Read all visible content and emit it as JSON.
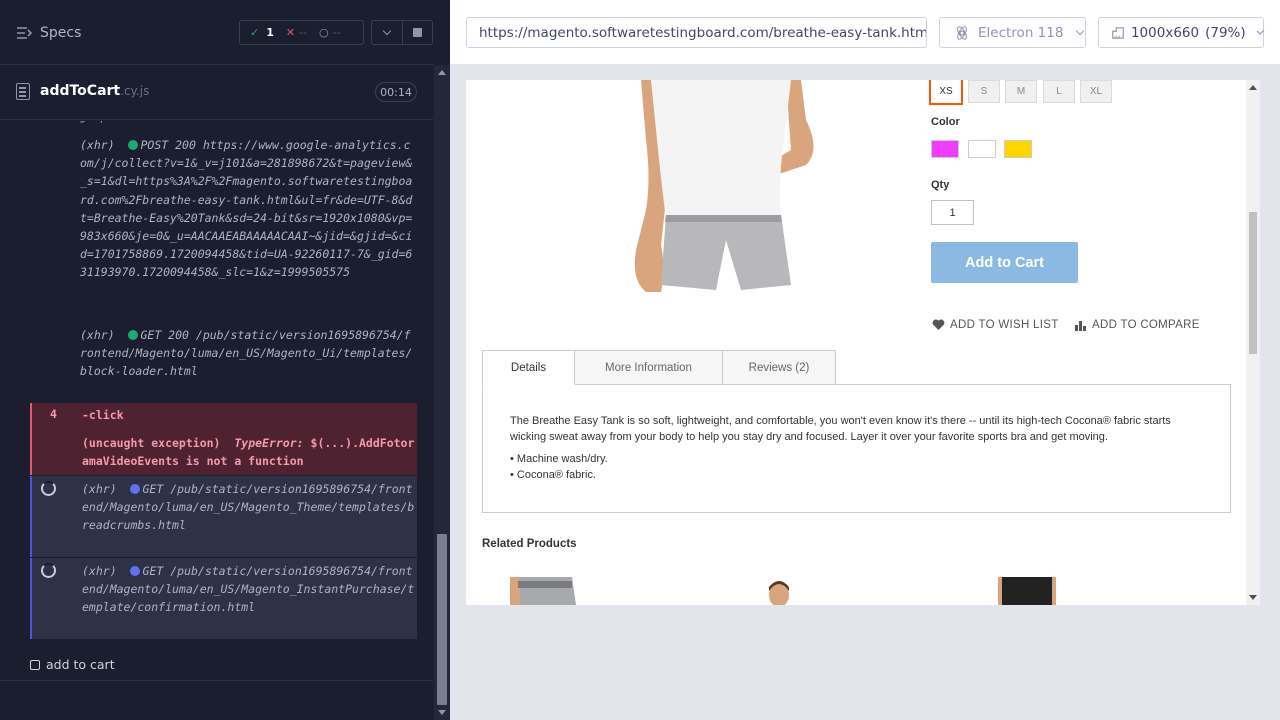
{
  "reporter": {
    "specs_label": "Specs",
    "stats": {
      "passed": "1",
      "failed": "--",
      "pending": "--"
    },
    "spec": {
      "name": "addToCart",
      "ext": ".cy.js",
      "duration": "00:14"
    },
    "commands": [
      {
        "type": "(xhr)",
        "method": "POST 200",
        "url": "https://www.google-analytics.com/j/collect?v=1&_v=j101&a=281898672&t=pageview&_s=1&dl=https%3A%2F%2Fmagento.softwaretestingboard.com%2Fbreathe-easy-tank.html&ul=fr&de=UTF-8&dt=Breathe-Easy%20Tank&sd=24-bit&sr=1920x1080&vp=983x660&je=0&_u=AACAAEABAAAAACAAI~&jid=&gjid=&cid=1701758869.1720094458&tid=UA-92260117-7&_gid=631193970.1720094458&_slc=1&z=1999505575"
      },
      {
        "type": "(xhr)",
        "method": "GET 200",
        "url": "/pub/static/version1695896754/frontend/Magento/luma/en_US/Magento_Ui/templates/block-loader.html"
      },
      {
        "num": "4",
        "name": "-click",
        "error_label": "(uncaught exception)",
        "error_type": "TypeError:",
        "error_msg": "$(...).AddFotoramaVideoEvents is not a function"
      },
      {
        "type": "(xhr)",
        "method": "GET",
        "url": "/pub/static/version1695896754/frontend/Magento/luma/en_US/Magento_Theme/templates/breadcrumbs.html"
      },
      {
        "type": "(xhr)",
        "method": "GET",
        "url": "/pub/static/version1695896754/frontend/Magento/luma/en_US/Magento_InstantPurchase/template/confirmation.html"
      }
    ],
    "test_title": "add to cart"
  },
  "aut": {
    "url": "https://magento.softwaretestingboard.com/breathe-easy-tank.html",
    "browser": "Electron 118",
    "viewport": "1000x660",
    "zoom": "(79%)"
  },
  "page": {
    "sizes": [
      "XS",
      "S",
      "M",
      "L",
      "XL"
    ],
    "selected_size": "XS",
    "color_label": "Color",
    "colors": [
      "#ef3dff",
      "#ffffff",
      "#ffd500"
    ],
    "qty_label": "Qty",
    "qty_value": "1",
    "add_to_cart": "Add to Cart",
    "wish_list": "ADD TO WISH LIST",
    "compare": "ADD TO COMPARE",
    "tabs": [
      "Details",
      "More Information",
      "Reviews (2)"
    ],
    "description": "The Breathe Easy Tank is so soft, lightweight, and comfortable, you won't even know it's there -- until its high-tech Cocona® fabric starts wicking sweat away from your body to help you stay dry and focused. Layer it over your favorite sports bra and get moving.",
    "bullets": [
      "• Machine wash/dry.",
      "• Cocona® fabric."
    ],
    "related_title": "Related Products"
  }
}
